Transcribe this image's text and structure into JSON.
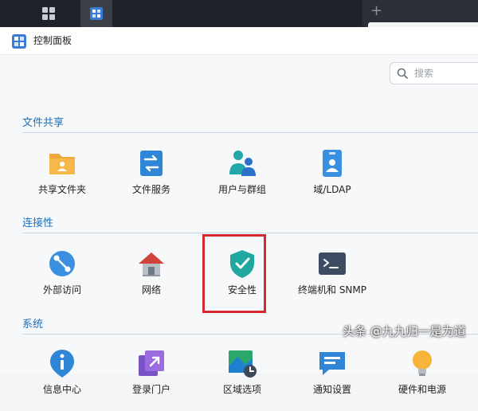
{
  "window": {
    "title": "控制面板"
  },
  "search": {
    "placeholder": "搜索"
  },
  "sections": [
    {
      "title": "文件共享",
      "items": [
        {
          "label": "共享文件夹",
          "icon": "shared-folder-icon"
        },
        {
          "label": "文件服务",
          "icon": "file-services-icon"
        },
        {
          "label": "用户与群组",
          "icon": "user-group-icon"
        },
        {
          "label": "域/LDAP",
          "icon": "domain-ldap-icon"
        }
      ]
    },
    {
      "title": "连接性",
      "items": [
        {
          "label": "外部访问",
          "icon": "external-access-icon"
        },
        {
          "label": "网络",
          "icon": "network-icon"
        },
        {
          "label": "安全性",
          "icon": "security-shield-icon"
        },
        {
          "label": "终端机和 SNMP",
          "icon": "terminal-snmp-icon"
        }
      ]
    },
    {
      "title": "系统",
      "items": [
        {
          "label": "信息中心",
          "icon": "info-center-icon"
        },
        {
          "label": "登录门户",
          "icon": "login-portal-icon"
        },
        {
          "label": "区域选项",
          "icon": "regional-options-icon"
        },
        {
          "label": "通知设置",
          "icon": "notification-icon"
        },
        {
          "label": "硬件和电源",
          "icon": "hardware-power-icon"
        }
      ]
    }
  ],
  "watermark": "头条 @九九归一是为道",
  "colors": {
    "accent": "#1e6fb8",
    "highlight": "#d7282f",
    "taskbar": "#1f2329"
  }
}
